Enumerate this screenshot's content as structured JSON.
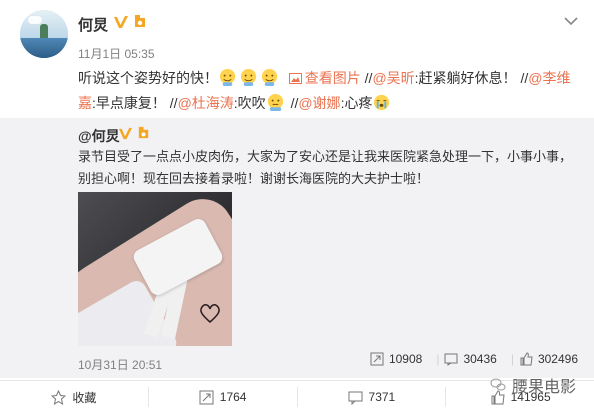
{
  "post": {
    "username": "何炅",
    "timestamp": "11月1日 05:35",
    "text": {
      "part1": "听说这个姿势好的快！",
      "view_image": "查看图片",
      "sep1": "//",
      "mention1": "@吴昕",
      "mention1_text": ":赶紧躺好休息！",
      "sep2": "//",
      "mention2": "@李维嘉",
      "mention2_text": ":早点康复！",
      "sep3": "//",
      "mention3": "@杜海涛",
      "mention3_text": ":吹吹",
      "sep4": "//",
      "mention4": "@谢娜",
      "mention4_text": ":心疼"
    }
  },
  "repost": {
    "username": "@何炅",
    "text": "录节目受了一点点小皮肉伤，大家为了安心还是让我来医院紧急处理一下，小事小事，别担心啊！现在回去接着录啦！谢谢长海医院的大夫护士啦！",
    "timestamp": "10月31日 20:51",
    "stats": {
      "reposts": "10908",
      "comments": "30436",
      "likes": "302496"
    }
  },
  "bottom_bar": {
    "favorite": "收藏",
    "repost": "1764",
    "comment": "7371",
    "like": "141965"
  },
  "watermark": "腰果电影",
  "colors": {
    "link": "#eb7350",
    "repost_bg": "#f2f2f5",
    "verified": "#f5a623"
  },
  "icons": [
    "verified-icon",
    "vip-level-icon",
    "menu-chevron-icon",
    "emoji-icon",
    "picture-icon",
    "repost-icon",
    "comment-icon",
    "like-icon",
    "favorite-icon",
    "wechat-icon"
  ]
}
